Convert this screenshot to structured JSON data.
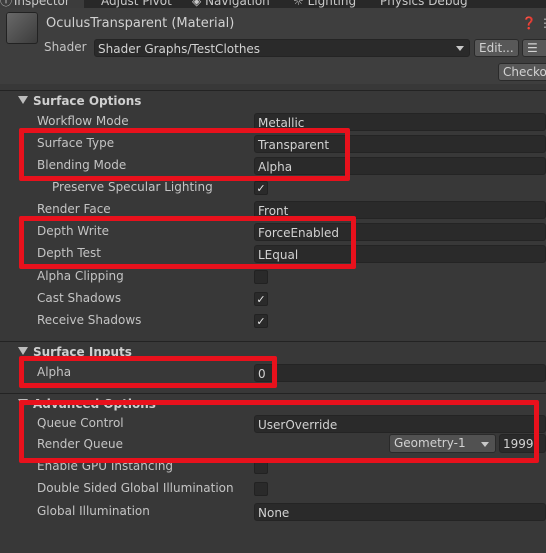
{
  "tabs": [
    {
      "label": "Inspector",
      "active": true
    },
    {
      "label": "Adjust Pivot",
      "active": false
    },
    {
      "label": "Navigation",
      "active": false
    },
    {
      "label": "Lighting",
      "active": false
    },
    {
      "label": "Physics Debug",
      "active": false
    }
  ],
  "header": {
    "title": "OculusTransparent (Material)",
    "shader_label": "Shader",
    "shader_value": "Shader Graphs/TestClothes",
    "edit_button": "Edit...",
    "checkout_button": "Checkout"
  },
  "surface_options": {
    "title": "Surface Options",
    "rows": [
      {
        "label": "Workflow Mode",
        "value": "Metallic"
      },
      {
        "label": "Surface Type",
        "value": "Transparent"
      },
      {
        "label": "Blending Mode",
        "value": "Alpha"
      },
      {
        "label": "Preserve Specular Lighting",
        "checked": true
      },
      {
        "label": "Render Face",
        "value": "Front"
      },
      {
        "label": "Depth Write",
        "value": "ForceEnabled"
      },
      {
        "label": "Depth Test",
        "value": "LEqual"
      },
      {
        "label": "Alpha Clipping",
        "checked": false
      },
      {
        "label": "Cast Shadows",
        "checked": true
      },
      {
        "label": "Receive Shadows",
        "checked": true
      }
    ]
  },
  "surface_inputs": {
    "title": "Surface Inputs",
    "alpha_label": "Alpha",
    "alpha_value": "0"
  },
  "advanced_options": {
    "title": "Advanced Options",
    "queue_control_label": "Queue Control",
    "queue_control_value": "UserOverride",
    "render_queue_label": "Render Queue",
    "render_queue_dropdown": "Geometry-1",
    "render_queue_value": "1999",
    "gpu_instancing_label": "Enable GPU Instancing",
    "gpu_instancing_checked": false,
    "double_sided_gi_label": "Double Sided Global Illumination",
    "double_sided_gi_checked": false,
    "global_illumination_label": "Global Illumination",
    "global_illumination_value": "None"
  },
  "colors": {
    "background": "#383838",
    "field": "#2a2a2a",
    "highlight": "#e8111c"
  }
}
